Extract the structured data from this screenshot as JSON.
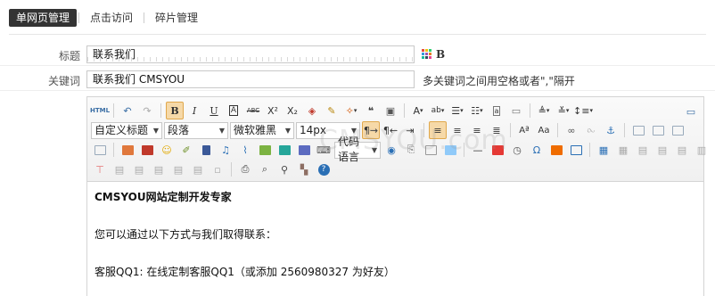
{
  "tabs": [
    {
      "label": "单网页管理",
      "active": true
    },
    {
      "label": "点击访问",
      "active": false
    },
    {
      "label": "碎片管理",
      "active": false
    }
  ],
  "form": {
    "title_label": "标题",
    "title_value": "联系我们",
    "bold_label": "B",
    "keywords_label": "关键词",
    "keywords_value": "联系我们 CMSYOU",
    "keywords_hint": "多关键词之间用空格或者\",\"隔开"
  },
  "editor": {
    "toolbar": {
      "html_label": "HTML",
      "bold": "B",
      "italic": "I",
      "underline": "U",
      "strike": "ABC",
      "custom_title": "自定义标题",
      "paragraph": "段落",
      "font_family": "微软雅黑",
      "font_size": "14px",
      "code_language": "代码语言"
    },
    "content": {
      "heading": "CMSYOU网站定制开发专家",
      "line1": "您可以通过以下方式与我们取得联系：",
      "line2": "客服QQ1: 在线定制客服QQ1（或添加 2560980327 为好友）"
    }
  },
  "watermark": "CMSYOU.com",
  "colors": {
    "accent_active_tab": "#333333",
    "button_active": "#f6d9a8"
  }
}
